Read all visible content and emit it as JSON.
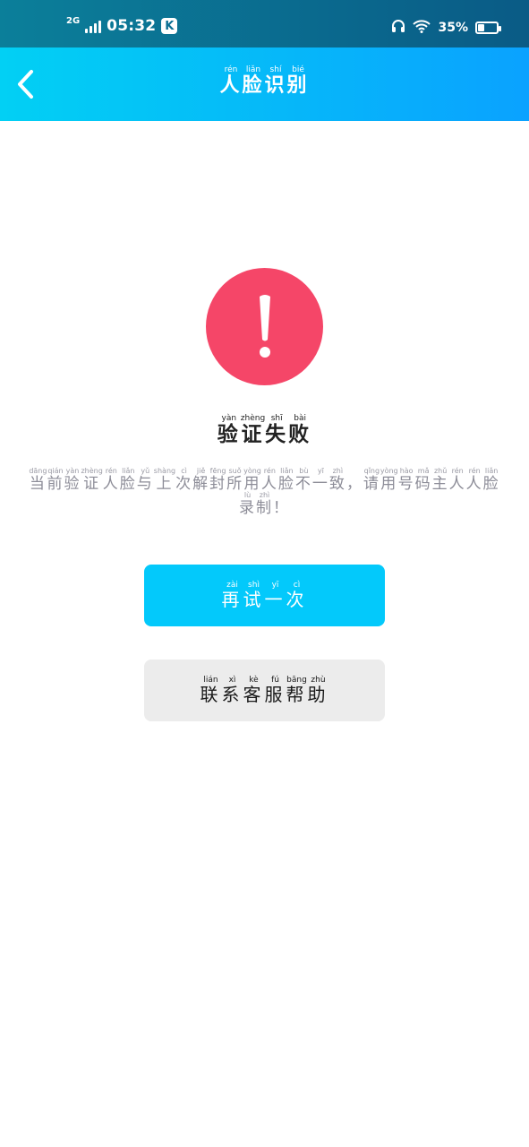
{
  "status_bar": {
    "network": "2G",
    "time": "05:32",
    "app_badge": "K",
    "battery_percent": "35%",
    "battery_level": 0.35,
    "icons": [
      "signal-icon",
      "k-badge-icon",
      "headphones-icon",
      "wifi-icon",
      "battery-icon"
    ]
  },
  "header": {
    "title_chars": [
      "人",
      "脸",
      "识",
      "别"
    ],
    "title_pinyin": [
      "rén",
      "liǎn",
      "shí",
      "bié"
    ],
    "back_icon": "chevron-left-icon"
  },
  "result": {
    "icon": "exclamation-alert-icon",
    "icon_color": "#f54668",
    "title_chars": [
      "验",
      "证",
      "失",
      "败"
    ],
    "title_pinyin": [
      "yàn",
      "zhèng",
      "shī",
      "bài"
    ],
    "description_chars": [
      "当",
      "前",
      "验",
      "证",
      "人",
      "脸",
      "与",
      "上",
      "次",
      "解",
      "封",
      "所",
      "用",
      "人",
      "脸",
      "不",
      "一",
      "致",
      "，",
      "请",
      "用",
      "号",
      "码",
      "主",
      "人",
      "人",
      "脸",
      "录",
      "制",
      "！"
    ],
    "description_pinyin": [
      "dāng",
      "qián",
      "yàn",
      "zhèng",
      "rén",
      "liǎn",
      "yǔ",
      "shàng",
      "cì",
      "jiě",
      "fēng",
      "suǒ",
      "yòng",
      "rén",
      "liǎn",
      "bù",
      "yī",
      "zhì",
      "",
      "qǐng",
      "yòng",
      "hào",
      "mǎ",
      "zhǔ",
      "rén",
      "rén",
      "liǎn",
      "lù",
      "zhì",
      ""
    ]
  },
  "buttons": {
    "retry_chars": [
      "再",
      "试",
      "一",
      "次"
    ],
    "retry_pinyin": [
      "zài",
      "shì",
      "yī",
      "cì"
    ],
    "retry_color": "#03c9fb",
    "help_chars": [
      "联",
      "系",
      "客",
      "服",
      "帮",
      "助"
    ],
    "help_pinyin": [
      "lián",
      "xì",
      "kè",
      "fú",
      "bāng",
      "zhù"
    ],
    "help_color": "#ececec"
  }
}
